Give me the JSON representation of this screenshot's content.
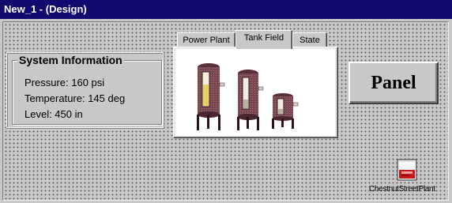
{
  "window": {
    "title": "New_1 - (Design)"
  },
  "system_info": {
    "title": "System Information",
    "pressure": "Pressure: 160 psi",
    "temperature": "Temperature: 145 deg",
    "level": "Level: 450 in"
  },
  "tabs": [
    {
      "label": "Power Plant",
      "active": false
    },
    {
      "label": "Tank Field",
      "active": true
    },
    {
      "label": "State",
      "active": false
    }
  ],
  "panel_button": {
    "label": "Panel"
  },
  "shortcut": {
    "label": "ChestnutStreetPlant",
    "icon": "plant-display-icon"
  },
  "colors": {
    "titlebar": "#120a6e",
    "background": "#c8c8c8",
    "tank_body": "#7a4650",
    "tank_glass": "#e8d060",
    "icon_red": "#c81818"
  }
}
